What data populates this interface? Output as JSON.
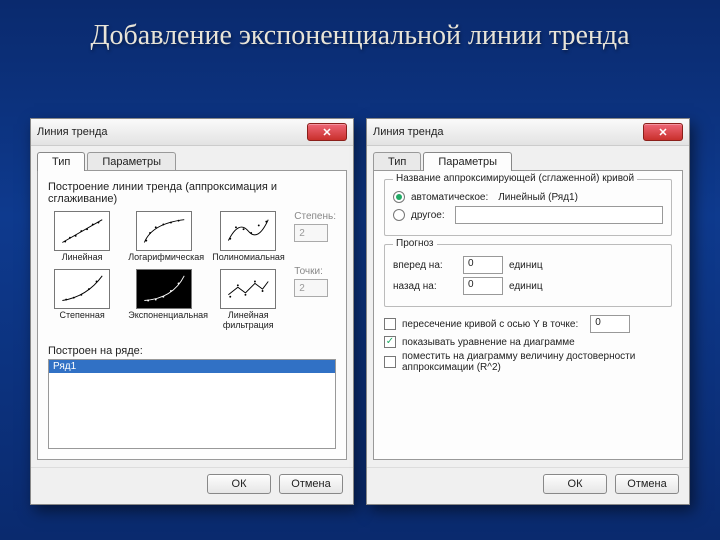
{
  "slide": {
    "title": "Добавление экспоненциальной линии тренда"
  },
  "dialog1": {
    "title": "Линия тренда",
    "tabs": {
      "type": "Тип",
      "params": "Параметры"
    },
    "section": "Построение линии тренда (аппроксимация и сглаживание)",
    "types": {
      "linear": "Линейная",
      "log": "Логарифмическая",
      "poly": "Полиномиальная",
      "power": "Степенная",
      "exp": "Экспоненциальная",
      "movavg": "Линейная фильтрация"
    },
    "degree_label": "Степень:",
    "degree_value": "2",
    "points_label": "Точки:",
    "points_value": "2",
    "built_on": "Построен на ряде:",
    "series_item": "Ряд1",
    "ok": "ОК",
    "cancel": "Отмена"
  },
  "dialog2": {
    "title": "Линия тренда",
    "tabs": {
      "type": "Тип",
      "params": "Параметры"
    },
    "name_group": "Название аппроксимирующей (сглаженной) кривой",
    "auto_label": "автоматическое:",
    "auto_value": "Линейный (Ряд1)",
    "other_label": "другое:",
    "other_value": "",
    "forecast_group": "Прогноз",
    "forward_label": "вперед на:",
    "forward_value": "0",
    "backward_label": "назад на:",
    "backward_value": "0",
    "units": "единиц",
    "intercept_label": "пересечение кривой с осью Y в точке:",
    "intercept_value": "0",
    "show_eq_label": "показывать уравнение на диаграмме",
    "show_r2_label": "поместить на диаграмму величину достоверности аппроксимации (R^2)",
    "ok": "ОК",
    "cancel": "Отмена"
  }
}
